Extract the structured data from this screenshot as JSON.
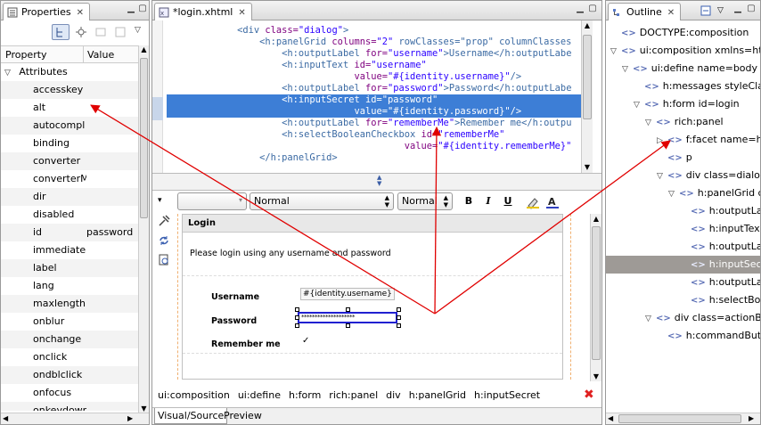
{
  "properties": {
    "tab_title": "Properties",
    "col_property": "Property",
    "col_value": "Value",
    "group": "Attributes",
    "rows": [
      {
        "name": "accesskey",
        "value": ""
      },
      {
        "name": "alt",
        "value": ""
      },
      {
        "name": "autocompl",
        "value": ""
      },
      {
        "name": "binding",
        "value": ""
      },
      {
        "name": "converter",
        "value": ""
      },
      {
        "name": "converterM",
        "value": ""
      },
      {
        "name": "dir",
        "value": ""
      },
      {
        "name": "disabled",
        "value": ""
      },
      {
        "name": "id",
        "value": "password"
      },
      {
        "name": "immediate",
        "value": ""
      },
      {
        "name": "label",
        "value": ""
      },
      {
        "name": "lang",
        "value": ""
      },
      {
        "name": "maxlength",
        "value": ""
      },
      {
        "name": "onblur",
        "value": ""
      },
      {
        "name": "onchange",
        "value": ""
      },
      {
        "name": "onclick",
        "value": ""
      },
      {
        "name": "ondblclick",
        "value": ""
      },
      {
        "name": "onfocus",
        "value": ""
      },
      {
        "name": "onkeydown",
        "value": ""
      }
    ]
  },
  "editor": {
    "tab_title": "*login.xhtml",
    "code": [
      {
        "indent": "            ",
        "tag": "<div ",
        "attr": "class=",
        "val": "\"dialog\"",
        "rest": ">"
      },
      {
        "indent": "                ",
        "tag": "<h:panelGrid ",
        "attr": "columns=",
        "val": "\"2\"",
        "rest": " rowClasses=\"prop\" columnClasses"
      },
      {
        "indent": "                    ",
        "tag": "<h:outputLabel ",
        "attr": "for=",
        "val": "\"username\"",
        "rest": ">Username</h:outputLabe"
      },
      {
        "indent": "                    ",
        "tag": "<h:inputText ",
        "attr": "id=",
        "val": "\"username\"",
        "rest": ""
      },
      {
        "indent": "                                 ",
        "tag": "",
        "attr": "value=",
        "val": "\"#{identity.username}\"",
        "rest": "/>"
      },
      {
        "indent": "                    ",
        "tag": "<h:outputLabel ",
        "attr": "for=",
        "val": "\"password\"",
        "rest": ">Password</h:outputLabe"
      },
      {
        "indent": "                    ",
        "tag": "<h:inputSecret ",
        "attr": "id=",
        "val": "\"password\"",
        "rest": ""
      },
      {
        "indent": "                                 ",
        "tag": "",
        "attr": "value=",
        "val": "\"#{identity.password}\"",
        "rest": "/>"
      },
      {
        "indent": "                    ",
        "tag": "<h:outputLabel ",
        "attr": "for=",
        "val": "\"rememberMe\"",
        "rest": ">Remember me</h:outpu"
      },
      {
        "indent": "                    ",
        "tag": "<h:selectBooleanCheckbox ",
        "attr": "id=",
        "val": "\"rememberMe\"",
        "rest": ""
      },
      {
        "indent": "                                          ",
        "tag": "",
        "attr": "value=",
        "val": "\"#{identity.rememberMe}\"",
        "rest": ""
      },
      {
        "indent": "                ",
        "tag": "</h:panelGrid>",
        "attr": "",
        "val": "",
        "rest": ""
      }
    ],
    "toolbar": {
      "style_select": "Normal",
      "size_select": "Normal",
      "bold": "B",
      "italic": "I",
      "underline": "U"
    },
    "preview": {
      "panel_title": "Login",
      "instructions": "Please login using any username and password",
      "username_label": "Username",
      "username_value": "#{identity.username}",
      "password_label": "Password",
      "password_value": "********************",
      "remember_label": "Remember me",
      "checkbox": "✓"
    },
    "breadcrumb": [
      "ui:composition",
      "ui:define",
      "h:form",
      "rich:panel",
      "div",
      "h:panelGrid",
      "h:inputSecret"
    ],
    "bottom_tabs": [
      "Visual/Source",
      "Preview"
    ]
  },
  "outline": {
    "tab_title": "Outline",
    "items": [
      {
        "label": "DOCTYPE:composition",
        "depth": 1,
        "arrow": ""
      },
      {
        "label": "ui:composition xmlns=http:",
        "depth": 1,
        "arrow": "▽"
      },
      {
        "label": "ui:define name=body",
        "depth": 2,
        "arrow": "▽"
      },
      {
        "label": "h:messages styleClas",
        "depth": 3,
        "arrow": ""
      },
      {
        "label": "h:form id=login",
        "depth": 3,
        "arrow": "▽"
      },
      {
        "label": "rich:panel",
        "depth": 4,
        "arrow": "▽"
      },
      {
        "label": "f:facet name=h",
        "depth": 5,
        "arrow": "▷"
      },
      {
        "label": "p",
        "depth": 5,
        "arrow": ""
      },
      {
        "label": "div class=dialog",
        "depth": 5,
        "arrow": "▽"
      },
      {
        "label": "h:panelGrid c",
        "depth": 6,
        "arrow": "▽"
      },
      {
        "label": "h:outputLa",
        "depth": 7,
        "arrow": ""
      },
      {
        "label": "h:inputTex",
        "depth": 7,
        "arrow": ""
      },
      {
        "label": "h:outputLa",
        "depth": 7,
        "arrow": ""
      },
      {
        "label": "h:inputSec",
        "depth": 7,
        "arrow": "",
        "selected": true
      },
      {
        "label": "h:outputLa",
        "depth": 7,
        "arrow": ""
      },
      {
        "label": "h:selectBo",
        "depth": 7,
        "arrow": ""
      },
      {
        "label": "div class=actionBu",
        "depth": 4,
        "arrow": "▽"
      },
      {
        "label": "h:commandButt",
        "depth": 5,
        "arrow": ""
      }
    ]
  },
  "colors": {
    "selection": "#3d7ed6",
    "arrow": "#e00000",
    "outline_selected": "#9e9a96"
  }
}
